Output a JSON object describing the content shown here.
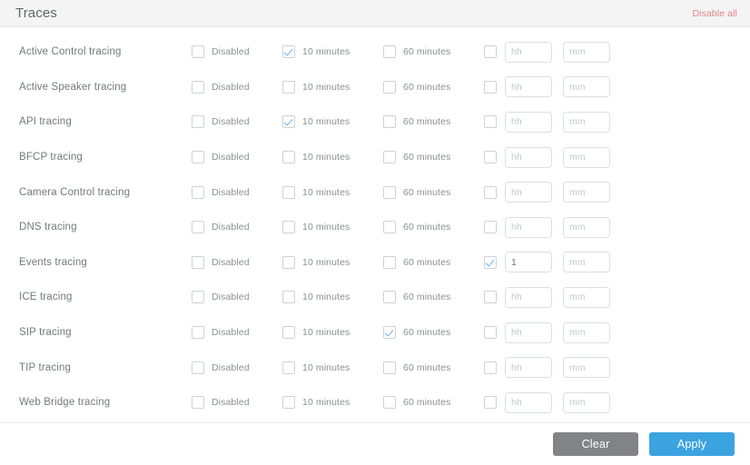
{
  "header": {
    "title": "Traces",
    "disable_all_label": "Disable all",
    "disable_all_color": "#e08586",
    "background": "#f4f4f5"
  },
  "columns": {
    "disabled_label": "Disabled",
    "ten_minutes_label": "10 minutes",
    "sixty_minutes_label": "60 minutes",
    "hh_placeholder": "hh",
    "mm_placeholder": "mm"
  },
  "rows": [
    {
      "label": "Active Control tracing",
      "disabled_checked": false,
      "ten_minutes_checked": true,
      "sixty_minutes_checked": false,
      "custom_checked": false,
      "hh_value": "",
      "mm_value": ""
    },
    {
      "label": "Active Speaker tracing",
      "disabled_checked": false,
      "ten_minutes_checked": false,
      "sixty_minutes_checked": false,
      "custom_checked": false,
      "hh_value": "",
      "mm_value": ""
    },
    {
      "label": "API tracing",
      "disabled_checked": false,
      "ten_minutes_checked": true,
      "sixty_minutes_checked": false,
      "custom_checked": false,
      "hh_value": "",
      "mm_value": ""
    },
    {
      "label": "BFCP tracing",
      "disabled_checked": false,
      "ten_minutes_checked": false,
      "sixty_minutes_checked": false,
      "custom_checked": false,
      "hh_value": "",
      "mm_value": ""
    },
    {
      "label": "Camera Control tracing",
      "disabled_checked": false,
      "ten_minutes_checked": false,
      "sixty_minutes_checked": false,
      "custom_checked": false,
      "hh_value": "",
      "mm_value": ""
    },
    {
      "label": "DNS tracing",
      "disabled_checked": false,
      "ten_minutes_checked": false,
      "sixty_minutes_checked": false,
      "custom_checked": false,
      "hh_value": "",
      "mm_value": ""
    },
    {
      "label": "Events tracing",
      "disabled_checked": false,
      "ten_minutes_checked": false,
      "sixty_minutes_checked": false,
      "custom_checked": true,
      "hh_value": "1",
      "mm_value": ""
    },
    {
      "label": "ICE tracing",
      "disabled_checked": false,
      "ten_minutes_checked": false,
      "sixty_minutes_checked": false,
      "custom_checked": false,
      "hh_value": "",
      "mm_value": ""
    },
    {
      "label": "SIP tracing",
      "disabled_checked": false,
      "ten_minutes_checked": false,
      "sixty_minutes_checked": true,
      "custom_checked": false,
      "hh_value": "",
      "mm_value": ""
    },
    {
      "label": "TIP tracing",
      "disabled_checked": false,
      "ten_minutes_checked": false,
      "sixty_minutes_checked": false,
      "custom_checked": false,
      "hh_value": "",
      "mm_value": ""
    },
    {
      "label": "Web Bridge tracing",
      "disabled_checked": false,
      "ten_minutes_checked": false,
      "sixty_minutes_checked": false,
      "custom_checked": false,
      "hh_value": "",
      "mm_value": ""
    }
  ],
  "footer": {
    "clear_label": "Clear",
    "apply_label": "Apply",
    "clear_color": "#808487",
    "apply_color": "#3ba3e0"
  }
}
